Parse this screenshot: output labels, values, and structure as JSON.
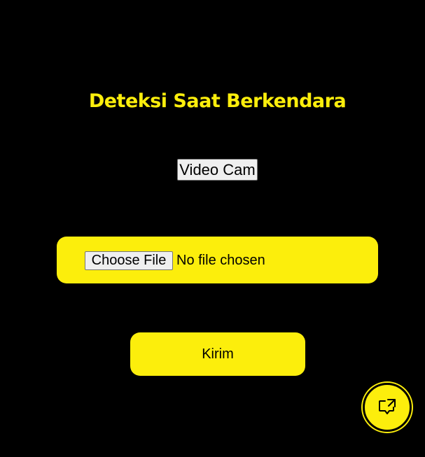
{
  "header": {
    "title": "Deteksi Saat Berkendara"
  },
  "video": {
    "button_label": "Video Cam"
  },
  "file_input": {
    "button_label": "Choose File",
    "status_text": "No file chosen"
  },
  "form": {
    "submit_label": "Kirim"
  },
  "fab": {
    "icon": "feedback-chat-icon"
  },
  "colors": {
    "background": "#000000",
    "accent": "#FCEE0C"
  }
}
